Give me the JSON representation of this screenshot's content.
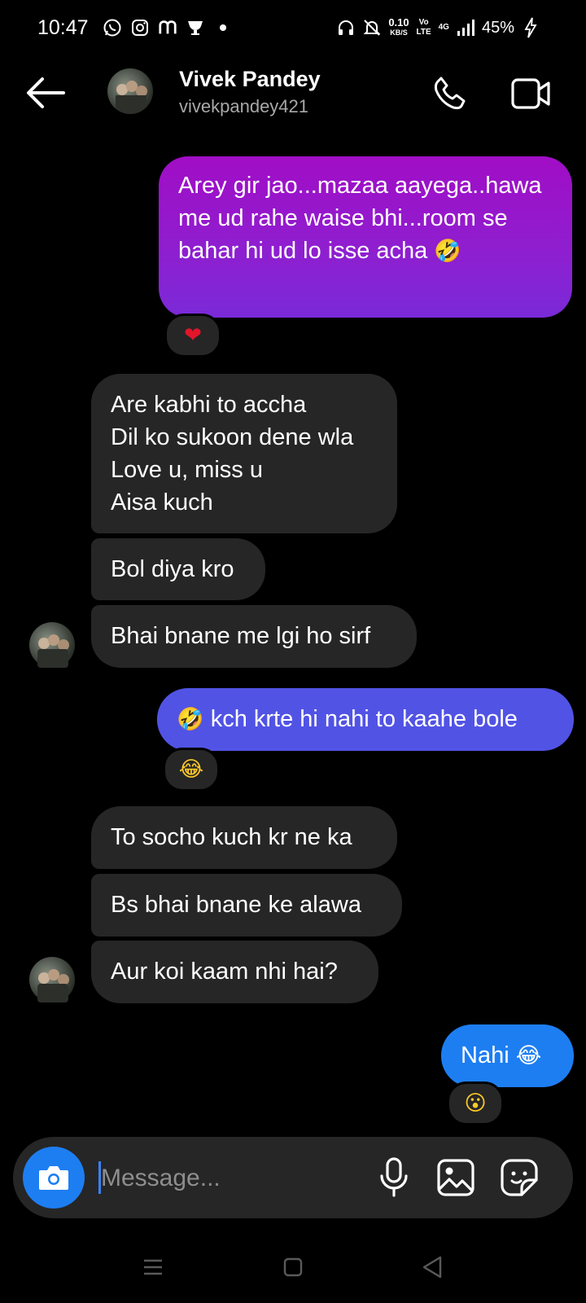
{
  "status_bar": {
    "time": "10:47",
    "net_speed": "0.10",
    "net_unit": "KB/S",
    "volte": "Vo LTE",
    "network": "4G",
    "battery": "45%"
  },
  "header": {
    "name": "Vivek Pandey",
    "username": "vivekpandey421"
  },
  "messages": [
    {
      "side": "out",
      "text": "Arey gir jao...mazaa aayega..hawa me ud rahe waise bhi...room se bahar hi ud lo isse acha",
      "emoji": "🤣",
      "reaction": "❤"
    },
    {
      "side": "in",
      "lines": [
        "Are kabhi to accha",
        "Dil ko sukoon dene wla",
        "Love u, miss u",
        "Aisa kuch"
      ]
    },
    {
      "side": "in",
      "text": "Bol diya kro"
    },
    {
      "side": "in",
      "text": "Bhai bnane me lgi ho sirf"
    },
    {
      "side": "out",
      "emoji": "🤣",
      "text": "kch krte hi nahi to kaahe bole",
      "reaction": "😂"
    },
    {
      "side": "in",
      "text": "To socho kuch kr ne ka"
    },
    {
      "side": "in",
      "text": "Bs bhai bnane ke alawa"
    },
    {
      "side": "in",
      "text": "Aur koi kaam nhi hai?"
    },
    {
      "side": "out",
      "text": "Nahi",
      "emoji": "😂",
      "reaction": "😮"
    }
  ],
  "composer": {
    "placeholder": "Message..."
  },
  "colors": {
    "bg": "#000000",
    "incoming_bubble": "#262626",
    "outgoing_purple": "#a10dc5",
    "outgoing_indigo": "#5153e5",
    "outgoing_blue": "#1d7ef2"
  },
  "icons": [
    "back-arrow-icon",
    "phone-icon",
    "video-camera-icon",
    "camera-icon",
    "microphone-icon",
    "gallery-icon",
    "sticker-icon"
  ]
}
